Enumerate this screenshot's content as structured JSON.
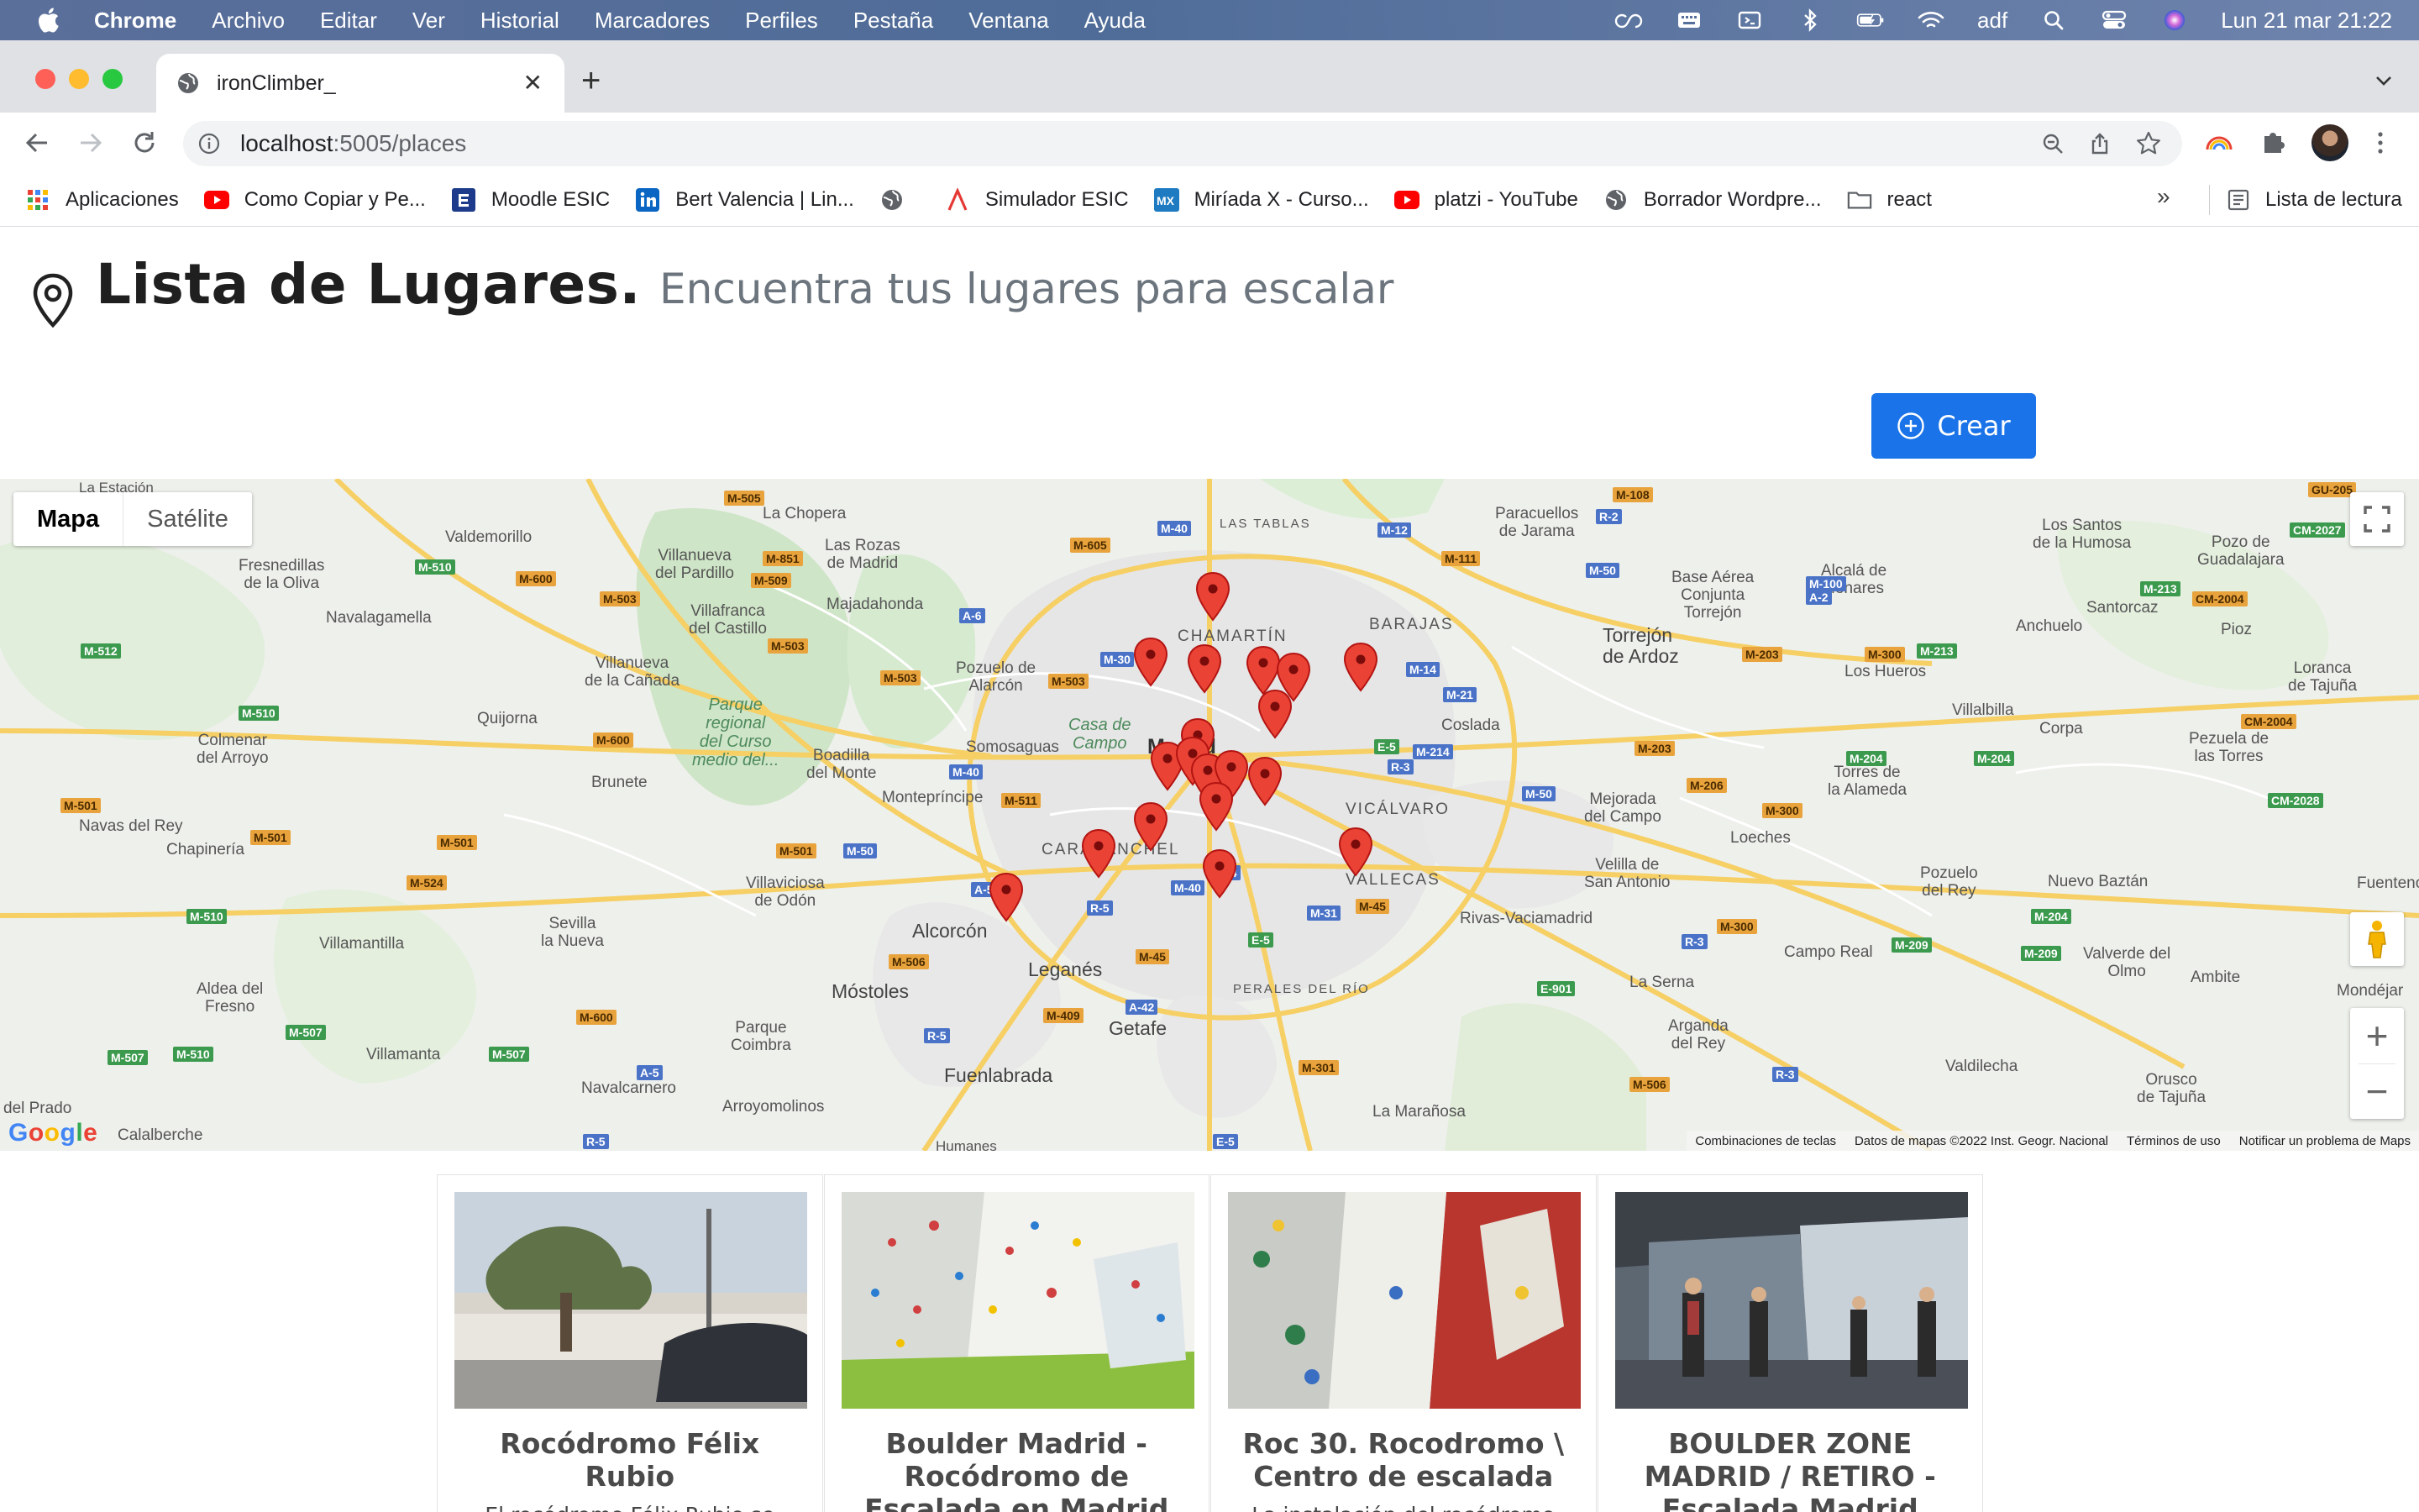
{
  "menubar": {
    "app": "Chrome",
    "items": [
      "Archivo",
      "Editar",
      "Ver",
      "Historial",
      "Marcadores",
      "Perfiles",
      "Pestaña",
      "Ventana",
      "Ayuda"
    ],
    "user": "adf",
    "datetime": "Lun 21 mar  21:22"
  },
  "browser": {
    "tab_title": "ironClimber_",
    "url_host": "localhost",
    "url_path": ":5005/places",
    "bookmarks": [
      {
        "label": "Aplicaciones",
        "icon": "apps-grid-icon"
      },
      {
        "label": "Como Copiar y Pe...",
        "icon": "youtube-icon"
      },
      {
        "label": "Moodle ESIC",
        "icon": "moodle-icon"
      },
      {
        "label": "Bert Valencia | Lin...",
        "icon": "linkedin-icon"
      },
      {
        "label": "",
        "icon": "globe-icon"
      },
      {
        "label": "Simulador ESIC",
        "icon": "esic-icon"
      },
      {
        "label": "Miríada X - Curso...",
        "icon": "miriadax-icon"
      },
      {
        "label": "platzi - YouTube",
        "icon": "youtube-icon"
      },
      {
        "label": "Borrador Wordpre...",
        "icon": "globe-icon"
      },
      {
        "label": "react",
        "icon": "folder-icon"
      }
    ],
    "more": "»",
    "reading_list": "Lista de lectura"
  },
  "page": {
    "title": "Lista de Lugares.",
    "subtitle": "Encuentra tus lugares para escalar",
    "create_label": "Crear"
  },
  "map": {
    "type_map": "Mapa",
    "type_satellite": "Satélite",
    "footer": {
      "shortcuts": "Combinaciones de teclas",
      "data": "Datos de mapas ©2022 Inst. Geogr. Nacional",
      "terms": "Términos de uso",
      "report": "Notificar un problema de Maps"
    },
    "google": [
      "G",
      "o",
      "o",
      "g",
      "l",
      "e"
    ],
    "labels": {
      "madrid": "Madrid",
      "chamartin": "CHAMARTÍN",
      "barajas": "BARAJAS",
      "vicalvaro": "VICÁLVARO",
      "vallecas": "VALLECAS",
      "carabanchel": "CARABANCHEL",
      "peralesdelrio": "PERALES DEL RÍO",
      "lastablas": "LAS TABLAS",
      "alcorcon": "Alcorcón",
      "mostoles": "Móstoles",
      "leganes": "Leganés",
      "getafe": "Getafe",
      "fuenlabrada": "Fuenlabrada",
      "torrejon": "Torrejón\nde Ardoz",
      "casadecampo": "Casa de\nCampo",
      "parqueregional": "Parque\nregional\ndel Curso\nmedio del...",
      "lachopera": "La Chopera",
      "lasrozas": "Las Rozas\nde Madrid",
      "majadahonda": "Majadahonda",
      "pozuelo": "Pozuelo de\nAlarcón",
      "somosaguas": "Somosaguas",
      "boadilla": "Boadilla\ndel Monte",
      "montepríncipe": "Montepríncipe",
      "villaviciosa": "Villaviciosa\nde Odón",
      "brunete": "Brunete",
      "quijorna": "Quijorna",
      "colmenar": "Colmenar\ndel Arroyo",
      "navasdelrey": "Navas del Rey",
      "chapineria": "Chapinería",
      "villamantilla": "Villamantilla",
      "sevilla": "Sevilla\nla Nueva",
      "aldea": "Aldea del\nFresno",
      "villamanta": "Villamanta",
      "navalcarnero": "Navalcarnero",
      "parquecoimbra": "Parque\nCoimbra",
      "arroyomolinos": "Arroyomolinos",
      "calalberche": "Calalberche",
      "delprado": "del Prado",
      "humanes": "Humanes",
      "valdemorillo": "Valdemorillo",
      "fresnedillas": "Fresnedillas\nde la Oliva",
      "navalagamella": "Navalagamella",
      "villanueva_canada": "Villanueva\nde la Cañada",
      "villanueva_pardillo": "Villanueva\ndel Pardillo",
      "villafranca": "Villafranca\ndel Castillo",
      "laestacion": "La Estación",
      "paracuellos": "Paracuellos\nde Jarama",
      "coslada": "Coslada",
      "mejorada": "Mejorada\ndel Campo",
      "velilla": "Velilla de\nSan Antonio",
      "rivas": "Rivas-Vaciamadrid",
      "laserna": "La Serna",
      "arganda": "Arganda\ndel Rey",
      "lamaranosa": "La Marañosa",
      "loeches": "Loeches",
      "torresalameda": "Torres de\nla Alameda",
      "pozuelodelrey": "Pozuelo\ndel Rey",
      "camporeal": "Campo Real",
      "valdilecha": "Valdilecha",
      "orusco": "Orusco\nde Tajuña",
      "ambite": "Ambite",
      "mondejar": "Mondéjar",
      "valverde": "Valverde del\nOlmo",
      "nuevobaztan": "Nuevo Baztán",
      "fuentenov": "Fuentenov",
      "villalbilla": "Villalbilla",
      "corpa": "Corpa",
      "pezuela": "Pezuela de\nlas Torres",
      "loranca": "Loranca\nde Tajuña",
      "pioz": "Pioz",
      "anchuelo": "Anchuelo",
      "santorcaz": "Santorcaz",
      "loshueros": "Los Hueros",
      "alcala": "Alcalá de\nHenares",
      "baseaerea": "Base Aérea\nConjunta\nTorrejón",
      "lossantos": "Los Santos\nde la Humosa",
      "pozodeguad": "Pozo de\nGuadalajara"
    }
  },
  "cards": [
    {
      "title": "Rocódromo Félix Rubio",
      "text": "El rocódromo Félix Rubio se"
    },
    {
      "title": "Boulder Madrid - Rocódromo de Escalada en Madrid",
      "text": ""
    },
    {
      "title": "Roc 30. Rocodromo \\ Centro de escalada",
      "text": "La instalación del rocódromo"
    },
    {
      "title": "BOULDER ZONE MADRID / RETIRO - Escalada Madrid",
      "text": ""
    }
  ],
  "colors": {
    "accent": "#1a73e8",
    "marker": "#ea4335",
    "menubar": "#5a6f9a"
  }
}
